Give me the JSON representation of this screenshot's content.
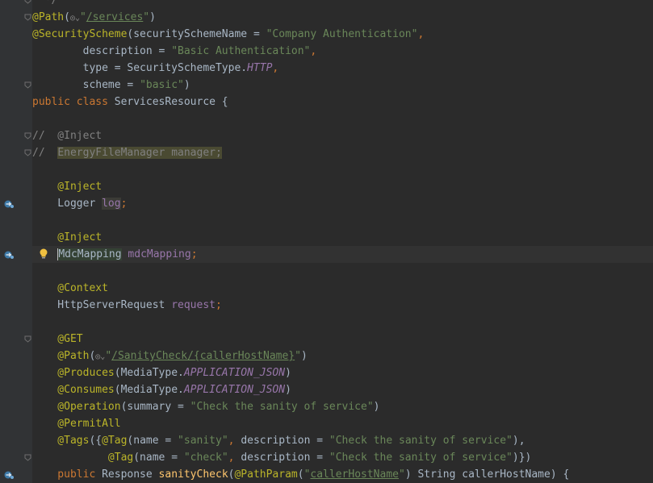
{
  "lines": [
    {
      "segments": [
        {
          "t": "  */",
          "c": "cmt"
        }
      ]
    },
    {
      "segments": [
        {
          "t": "@Path",
          "c": "ann"
        },
        {
          "t": "(",
          "c": "def"
        },
        {
          "t": "◎⌄",
          "c": "urlglyph"
        },
        {
          "t": "\"",
          "c": "str"
        },
        {
          "t": "/services",
          "c": "str ul"
        },
        {
          "t": "\"",
          "c": "str"
        },
        {
          "t": ")",
          "c": "def"
        }
      ]
    },
    {
      "segments": [
        {
          "t": "@SecurityScheme",
          "c": "ann"
        },
        {
          "t": "(securitySchemeName = ",
          "c": "def"
        },
        {
          "t": "\"Company Authentication\"",
          "c": "str"
        },
        {
          "t": ",",
          "c": "kw"
        }
      ]
    },
    {
      "segments": [
        {
          "t": "        description = ",
          "c": "def"
        },
        {
          "t": "\"Basic Authentication\"",
          "c": "str"
        },
        {
          "t": ",",
          "c": "kw"
        }
      ]
    },
    {
      "segments": [
        {
          "t": "        type = SecuritySchemeType.",
          "c": "def"
        },
        {
          "t": "HTTP",
          "c": "fld ital"
        },
        {
          "t": ",",
          "c": "kw"
        }
      ]
    },
    {
      "segments": [
        {
          "t": "        scheme = ",
          "c": "def"
        },
        {
          "t": "\"basic\"",
          "c": "str"
        },
        {
          "t": ")",
          "c": "def"
        }
      ]
    },
    {
      "segments": [
        {
          "t": "public class ",
          "c": "kw"
        },
        {
          "t": "ServicesResource {",
          "c": "def"
        }
      ]
    },
    {
      "segments": []
    },
    {
      "segments": [
        {
          "t": "//  @Inject",
          "c": "cmt"
        }
      ]
    },
    {
      "segments": [
        {
          "t": "//  ",
          "c": "cmt"
        },
        {
          "t": "EnergyFileManager manager;",
          "c": "cmt hl-manager"
        }
      ]
    },
    {
      "segments": []
    },
    {
      "segments": [
        {
          "t": "    @Inject",
          "c": "ann"
        }
      ]
    },
    {
      "segments": [
        {
          "t": "    Logger ",
          "c": "def"
        },
        {
          "t": "log",
          "c": "fld hl-log"
        },
        {
          "t": ";",
          "c": "kw"
        }
      ]
    },
    {
      "segments": []
    },
    {
      "segments": [
        {
          "t": "    @Inject",
          "c": "ann"
        }
      ]
    },
    {
      "segments": [
        {
          "t": "    ",
          "c": "def"
        },
        {
          "t": "MdcMapping",
          "c": "def hl-mdc caret"
        },
        {
          "t": " ",
          "c": "def"
        },
        {
          "t": "mdcMapping",
          "c": "fld"
        },
        {
          "t": ";",
          "c": "kw"
        }
      ],
      "caret": true
    },
    {
      "segments": []
    },
    {
      "segments": [
        {
          "t": "    @Context",
          "c": "ann"
        }
      ]
    },
    {
      "segments": [
        {
          "t": "    HttpServerRequest ",
          "c": "def"
        },
        {
          "t": "request",
          "c": "fld"
        },
        {
          "t": ";",
          "c": "kw"
        }
      ]
    },
    {
      "segments": []
    },
    {
      "segments": [
        {
          "t": "    @GET",
          "c": "ann"
        }
      ]
    },
    {
      "segments": [
        {
          "t": "    @Path",
          "c": "ann"
        },
        {
          "t": "(",
          "c": "def"
        },
        {
          "t": "◎⌄",
          "c": "urlglyph"
        },
        {
          "t": "\"",
          "c": "str"
        },
        {
          "t": "/SanityCheck/{callerHostName}",
          "c": "str ul"
        },
        {
          "t": "\"",
          "c": "str"
        },
        {
          "t": ")",
          "c": "def"
        }
      ]
    },
    {
      "segments": [
        {
          "t": "    @Produces",
          "c": "ann"
        },
        {
          "t": "(MediaType.",
          "c": "def"
        },
        {
          "t": "APPLICATION_JSON",
          "c": "fld ital"
        },
        {
          "t": ")",
          "c": "def"
        }
      ]
    },
    {
      "segments": [
        {
          "t": "    @Consumes",
          "c": "ann"
        },
        {
          "t": "(MediaType.",
          "c": "def"
        },
        {
          "t": "APPLICATION_JSON",
          "c": "fld ital"
        },
        {
          "t": ")",
          "c": "def"
        }
      ]
    },
    {
      "segments": [
        {
          "t": "    @Operation",
          "c": "ann"
        },
        {
          "t": "(summary = ",
          "c": "def"
        },
        {
          "t": "\"Check the sanity of service\"",
          "c": "str"
        },
        {
          "t": ")",
          "c": "def"
        }
      ]
    },
    {
      "segments": [
        {
          "t": "    @PermitAll",
          "c": "ann"
        }
      ]
    },
    {
      "segments": [
        {
          "t": "    @Tags",
          "c": "ann"
        },
        {
          "t": "({",
          "c": "def"
        },
        {
          "t": "@Tag",
          "c": "ann"
        },
        {
          "t": "(name = ",
          "c": "def"
        },
        {
          "t": "\"sanity\"",
          "c": "str"
        },
        {
          "t": ", ",
          "c": "kw"
        },
        {
          "t": "description = ",
          "c": "def"
        },
        {
          "t": "\"Check the sanity of service\"",
          "c": "str"
        },
        {
          "t": "),",
          "c": "def"
        }
      ]
    },
    {
      "segments": [
        {
          "t": "            @Tag",
          "c": "ann"
        },
        {
          "t": "(name = ",
          "c": "def"
        },
        {
          "t": "\"check\"",
          "c": "str"
        },
        {
          "t": ", ",
          "c": "kw"
        },
        {
          "t": "description = ",
          "c": "def"
        },
        {
          "t": "\"Check the sanity of service\"",
          "c": "str"
        },
        {
          "t": ")})",
          "c": "def"
        }
      ]
    },
    {
      "segments": [
        {
          "t": "    public ",
          "c": "kw"
        },
        {
          "t": "Response ",
          "c": "def"
        },
        {
          "t": "sanityCheck",
          "c": "fn"
        },
        {
          "t": "(",
          "c": "def"
        },
        {
          "t": "@PathParam",
          "c": "ann"
        },
        {
          "t": "(",
          "c": "def"
        },
        {
          "t": "\"",
          "c": "str"
        },
        {
          "t": "callerHostName",
          "c": "str ul"
        },
        {
          "t": "\"",
          "c": "str"
        },
        {
          "t": ") String callerHostName) {",
          "c": "def"
        }
      ]
    }
  ],
  "gutter_icons": [
    {
      "line": 12,
      "name": "injection-point-icon"
    },
    {
      "line": 15,
      "name": "injection-point-icon"
    },
    {
      "line": 28,
      "name": "endpoint-icon"
    }
  ],
  "fold_markers": [
    0,
    1,
    5,
    8,
    9,
    20,
    27
  ],
  "bulb_line": 15,
  "colors": {
    "background": "#2b2b2b",
    "gutter": "#313335",
    "keyword": "#cc7832",
    "annotation": "#bbb529",
    "string": "#6a8759",
    "comment": "#808080",
    "field": "#9876aa",
    "method": "#ffc66d",
    "default": "#a9b7c6",
    "bulb": "#f0c040"
  }
}
